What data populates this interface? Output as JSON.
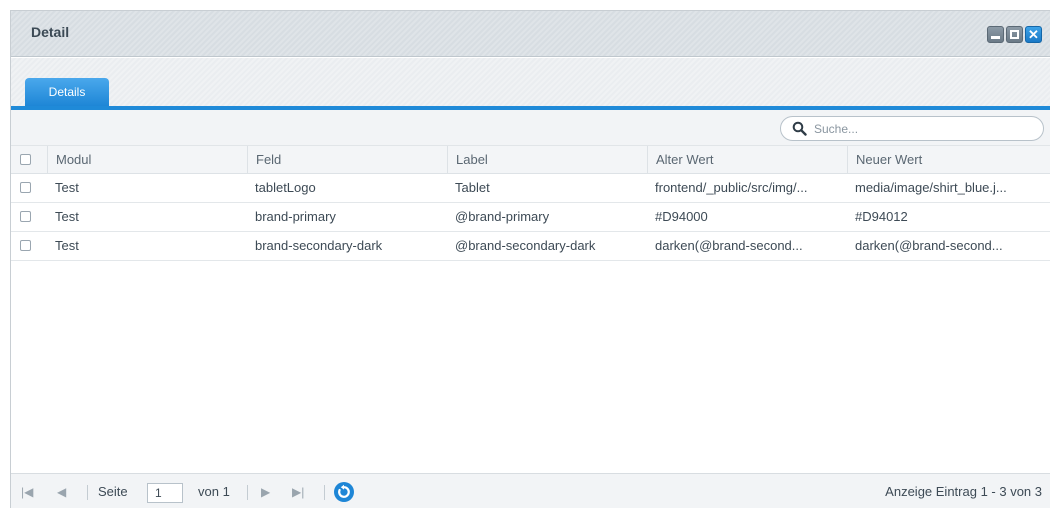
{
  "window": {
    "title": "Detail",
    "minimize_icon": "minimize-icon",
    "maximize_icon": "maximize-icon",
    "close_icon": "close-icon"
  },
  "tabs": [
    {
      "label": "Details",
      "active": true
    }
  ],
  "search": {
    "placeholder": "Suche...",
    "icon": "search-icon"
  },
  "grid": {
    "columns": [
      "Modul",
      "Feld",
      "Label",
      "Alter Wert",
      "Neuer Wert"
    ],
    "rows": [
      {
        "modul": "Test",
        "feld": "tabletLogo",
        "label": "Tablet",
        "alter_wert": "frontend/_public/src/img/...",
        "neuer_wert": "media/image/shirt_blue.j..."
      },
      {
        "modul": "Test",
        "feld": "brand-primary",
        "label": "@brand-primary",
        "alter_wert": "#D94000",
        "neuer_wert": "#D94012"
      },
      {
        "modul": "Test",
        "feld": "brand-secondary-dark",
        "label": "@brand-secondary-dark",
        "alter_wert": "darken(@brand-second...",
        "neuer_wert": "darken(@brand-second..."
      }
    ]
  },
  "pager": {
    "page_label": "Seite",
    "page_value": "1",
    "of_label": "von 1",
    "summary": "Anzeige Eintrag 1 - 3 von 3"
  },
  "colors": {
    "accent": "#1f8ad8",
    "window_button_gray": "#7b8a96",
    "close_button": "#1a79c6"
  }
}
